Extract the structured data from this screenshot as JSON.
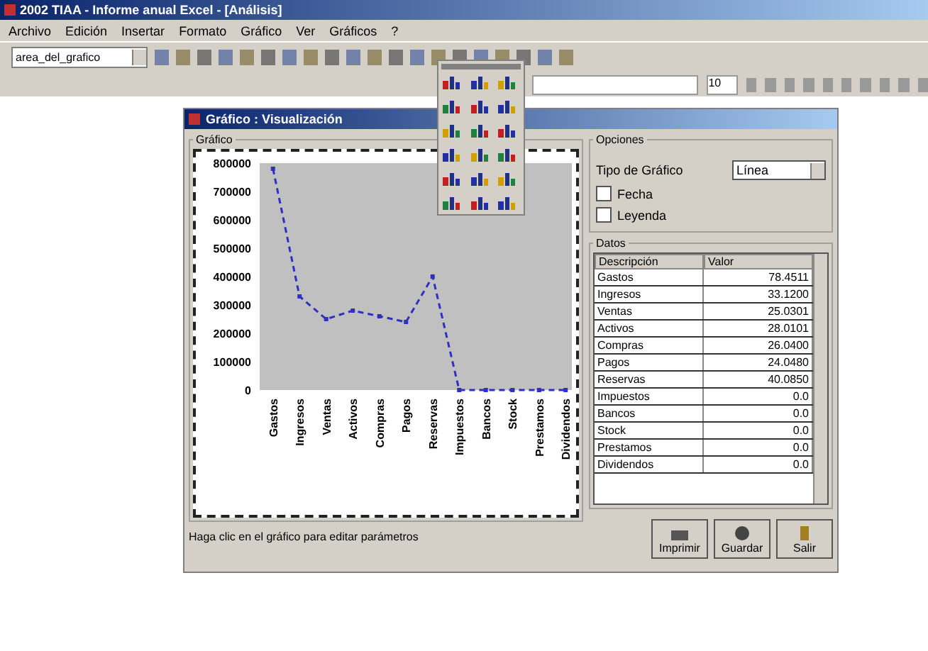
{
  "window": {
    "title": "2002 TIAA - Informe anual Excel - [Análisis]"
  },
  "menu": [
    "Archivo",
    "Edición",
    "Insertar",
    "Formato",
    "Gráfico",
    "Ver",
    "Gráficos",
    "?"
  ],
  "toolbar": {
    "name_box": "area_del_grafico",
    "font_size": "10"
  },
  "dialog": {
    "title": "Gráfico : Visualización",
    "chart_group": "Gráfico",
    "chart_data": {
      "type": "line",
      "categories": [
        "Gastos",
        "Ingresos",
        "Ventas",
        "Activos",
        "Compras",
        "Pagos",
        "Reservas",
        "Impuestos",
        "Bancos",
        "Stock",
        "Prestamos",
        "Dividendos"
      ],
      "series": [
        {
          "color": "#3030c0",
          "line_style": "dashed",
          "marker": "square",
          "values": [
            780000,
            330000,
            250000,
            280000,
            260000,
            240000,
            400000,
            0,
            0,
            0,
            0,
            0
          ]
        }
      ],
      "ylim": [
        0,
        800000
      ],
      "yticks": [
        0,
        100000,
        200000,
        300000,
        400000,
        500000,
        600000,
        700000,
        800000
      ]
    },
    "options_group": "Opciones",
    "type_label": "Tipo de Gráfico",
    "type_value": "Línea",
    "checks": [
      {
        "label": "Fecha",
        "checked": false
      },
      {
        "label": "Leyenda",
        "checked": false
      }
    ],
    "table_group": "Datos",
    "columns": [
      "Descripción",
      "Valor"
    ],
    "rows": [
      {
        "desc": "Gastos",
        "value": "78.4511"
      },
      {
        "desc": "Ingresos",
        "value": "33.1200"
      },
      {
        "desc": "Ventas",
        "value": "25.0301"
      },
      {
        "desc": "Activos",
        "value": "28.0101"
      },
      {
        "desc": "Compras",
        "value": "26.0400"
      },
      {
        "desc": "Pagos",
        "value": "24.0480"
      },
      {
        "desc": "Reservas",
        "value": "40.0850"
      },
      {
        "desc": "Impuestos",
        "value": "0.0"
      },
      {
        "desc": "Bancos",
        "value": "0.0"
      },
      {
        "desc": "Stock",
        "value": "0.0"
      },
      {
        "desc": "Prestamos",
        "value": "0.0"
      },
      {
        "desc": "Dividendos",
        "value": "0.0"
      }
    ],
    "status": "Haga clic en el gráfico para editar parámetros",
    "buttons": [
      {
        "label": "Imprimir",
        "kind": "print"
      },
      {
        "label": "Guardar",
        "kind": "save"
      },
      {
        "label": "Salir",
        "kind": "exit"
      }
    ]
  }
}
